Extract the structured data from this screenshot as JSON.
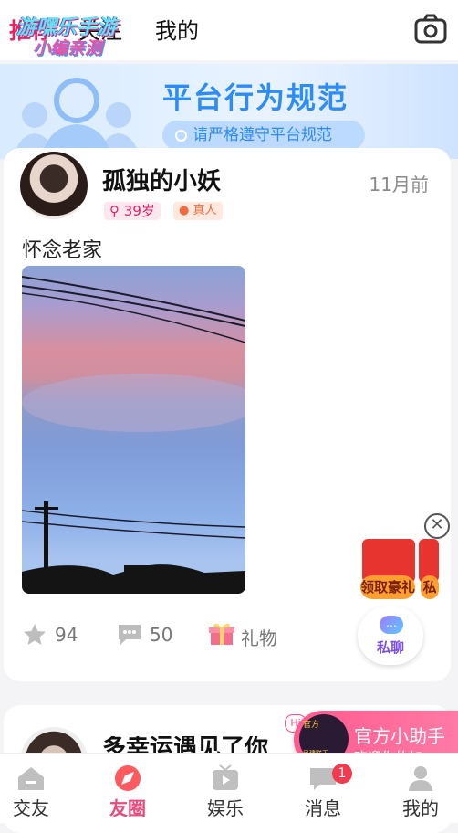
{
  "top_tabs": {
    "tab1": "推荐",
    "tab2": "关注",
    "tab3": "我的"
  },
  "watermark": {
    "line1": "游嘿乐手游",
    "line2": "小编亲测"
  },
  "banner": {
    "title": "平台行为规范",
    "pill": "请严格遵守平台规范"
  },
  "post": {
    "name": "孤独的小妖",
    "time": "11月前",
    "age": "39岁",
    "real": "真人",
    "text": "怀念老家",
    "likes": "94",
    "comments": "50",
    "gift": "礼物"
  },
  "floating": {
    "gift_label": "领取豪礼",
    "gift_label2": "私",
    "close": "✕",
    "chat_label": "私聊",
    "chat_bubble_text": "…"
  },
  "assistant": {
    "hi": "Hi",
    "avatar_text1": "官方",
    "avatar_text2": "民建联天",
    "title": "官方小助手",
    "subtitle": "欢迎你的加..."
  },
  "card2": {
    "name_partial": "多幸运遇见了你"
  },
  "nav": {
    "item1": "交友",
    "item2": "友圈",
    "item3": "娱乐",
    "item4": "消息",
    "item5": "我的",
    "badge": "1"
  },
  "colors": {
    "accent": "#e84b7a",
    "banner_blue": "#2d8cf5"
  }
}
